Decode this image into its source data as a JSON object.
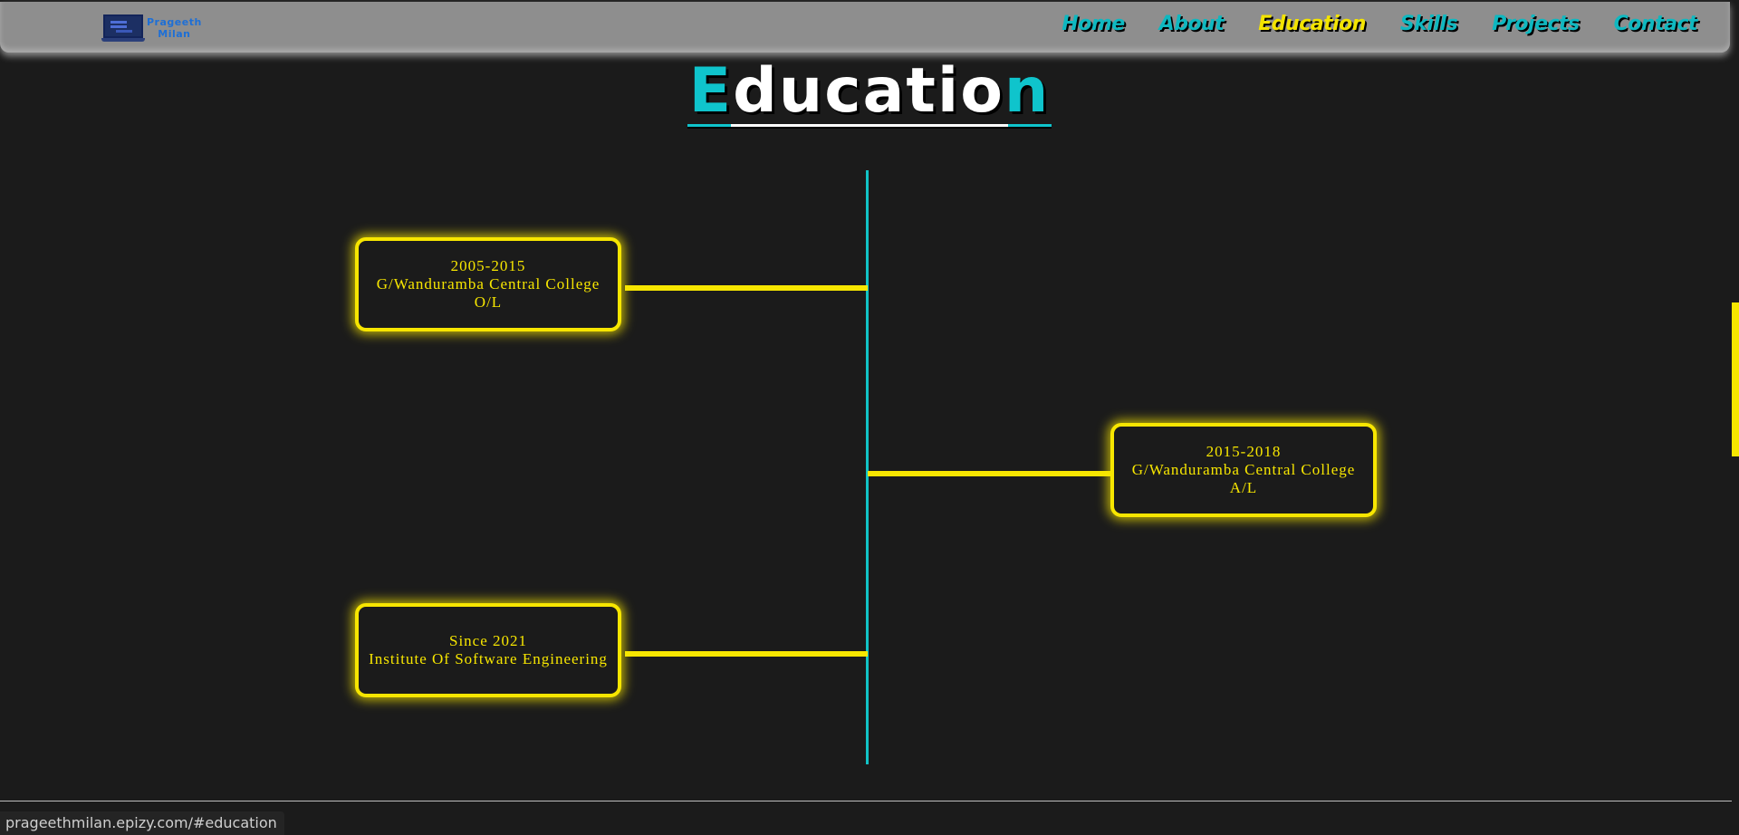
{
  "navbar": {
    "brand": {
      "line1": "Prageeth",
      "line2": "Milan",
      "logo_icon": "laptop-logo-icon"
    },
    "links": [
      {
        "label": "Home",
        "active": false
      },
      {
        "label": "About",
        "active": false
      },
      {
        "label": "Education",
        "active": true
      },
      {
        "label": "Skills",
        "active": false
      },
      {
        "label": "Projects",
        "active": false
      },
      {
        "label": "Contact",
        "active": false
      }
    ]
  },
  "section": {
    "title_first": "E",
    "title_middle": "ducatio",
    "title_last": "n"
  },
  "timeline": {
    "items": [
      {
        "years": "2005-2015",
        "school": "G/Wanduramba Central College",
        "level": "O/L",
        "side": "left"
      },
      {
        "years": "2015-2018",
        "school": "G/Wanduramba Central College",
        "level": "A/L",
        "side": "right"
      },
      {
        "years": "Since 2021",
        "school": "Institute Of Software Engineering",
        "level": "",
        "side": "left"
      }
    ]
  },
  "status_bar": {
    "url": "prageethmilan.epizy.com/#education"
  },
  "colors": {
    "background": "#1b1b1b",
    "navbar": "#8e8e8e",
    "accent_cyan": "#0fc4cc",
    "accent_yellow": "#f7e600",
    "nav_link": "#0fb8c0"
  }
}
